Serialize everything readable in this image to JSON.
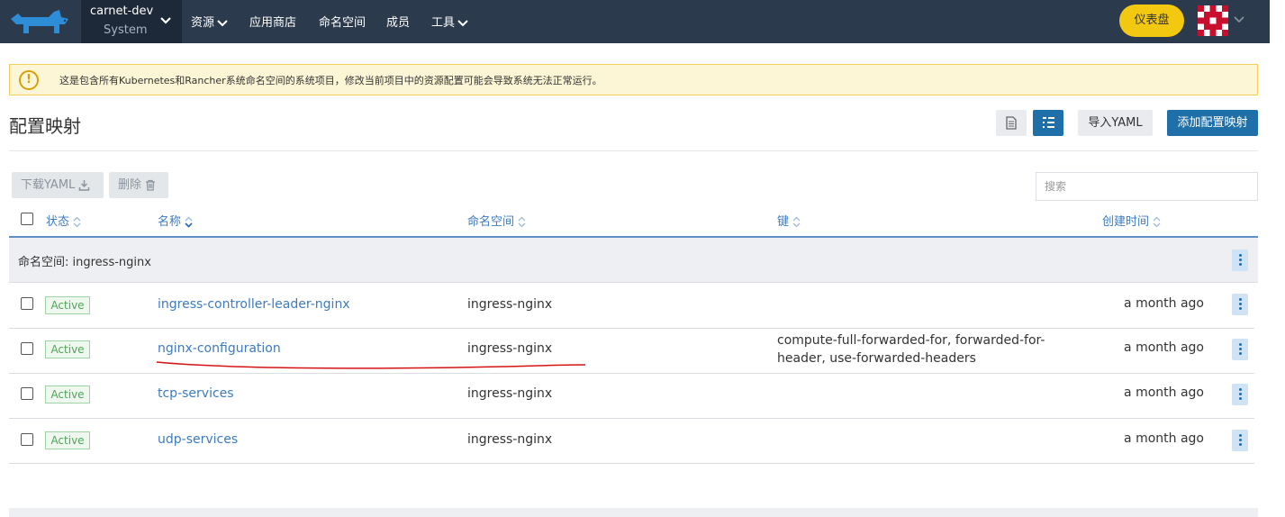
{
  "header": {
    "cluster_name": "carnet-dev",
    "cluster_subtitle": "System",
    "nav": [
      {
        "label": "资源",
        "has_dropdown": true
      },
      {
        "label": "应用商店",
        "has_dropdown": false
      },
      {
        "label": "命名空间",
        "has_dropdown": false
      },
      {
        "label": "成员",
        "has_dropdown": false
      },
      {
        "label": "工具",
        "has_dropdown": true
      }
    ],
    "dashboard_label": "仪表盘",
    "colors": {
      "bar": "#2b3a4d",
      "cluster_bg": "#1d2838",
      "dashboard": "#f2c811"
    }
  },
  "banner": {
    "text": "这是包含所有Kubernetes和Rancher系统命名空间的系统项目，修改当前项目中的资源配置可能会导致系统无法正常运行。",
    "icon": "warning-circle-icon"
  },
  "page": {
    "title": "配置映射",
    "import_yaml_label": "导入YAML",
    "add_label": "添加配置映射"
  },
  "toolbar": {
    "download_yaml_label": "下载YAML",
    "delete_label": "删除",
    "search_placeholder": "搜索"
  },
  "table": {
    "columns": {
      "state": "状态",
      "name": "名称",
      "namespace": "命名空间",
      "keys": "键",
      "created": "创建时间"
    },
    "group_label": "命名空间: ingress-nginx",
    "rows": [
      {
        "state": "Active",
        "name": "ingress-controller-leader-nginx",
        "namespace": "ingress-nginx",
        "keys": "",
        "created": "a month ago"
      },
      {
        "state": "Active",
        "name": "nginx-configuration",
        "namespace": "ingress-nginx",
        "keys": "compute-full-forwarded-for, forwarded-for-header, use-forwarded-headers",
        "created": "a month ago"
      },
      {
        "state": "Active",
        "name": "tcp-services",
        "namespace": "ingress-nginx",
        "keys": "",
        "created": "a month ago"
      },
      {
        "state": "Active",
        "name": "udp-services",
        "namespace": "ingress-nginx",
        "keys": "",
        "created": "a month ago"
      }
    ]
  }
}
